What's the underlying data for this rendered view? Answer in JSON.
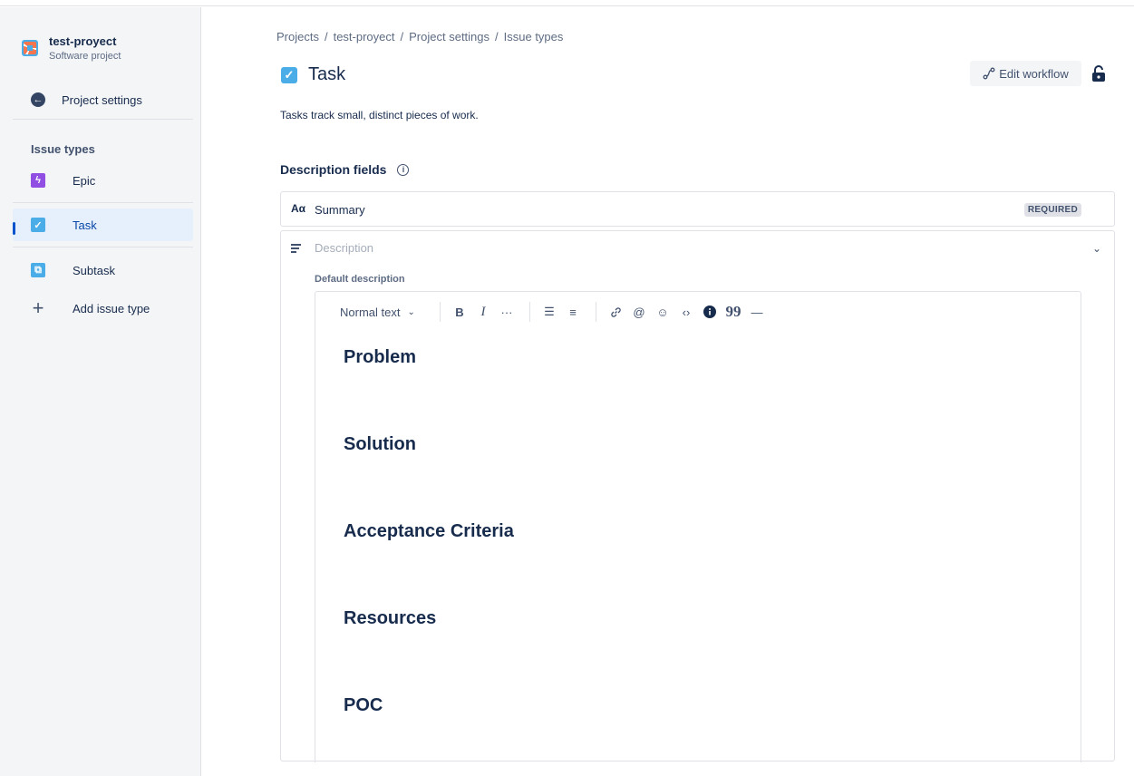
{
  "project": {
    "name": "test-proyect",
    "type": "Software project"
  },
  "sidebar": {
    "back_label": "Project settings",
    "section_title": "Issue types",
    "items": [
      {
        "label": "Epic",
        "icon": "epic-icon",
        "color": "#904EE2",
        "glyph": "ϟ"
      },
      {
        "label": "Task",
        "icon": "task-icon",
        "color": "#4BADE8",
        "glyph": "✓",
        "active": true
      },
      {
        "label": "Subtask",
        "icon": "subtask-icon",
        "color": "#4BADE8",
        "glyph": "⧉"
      }
    ],
    "add_label": "Add issue type"
  },
  "breadcrumb": [
    "Projects",
    "test-proyect",
    "Project settings",
    "Issue types"
  ],
  "page": {
    "title": "Task",
    "description": "Tasks track small, distinct pieces of work.",
    "edit_workflow": "Edit workflow"
  },
  "fields": {
    "heading": "Description fields",
    "summary": {
      "icon_text": "Aα",
      "label": "Summary",
      "badge": "REQUIRED"
    },
    "description": {
      "placeholder": "Description",
      "default_label": "Default description",
      "toolbar": {
        "text_style": "Normal text",
        "buttons": [
          "B",
          "I",
          "···",
          "☰",
          "≡",
          "🔗",
          "@",
          "☺",
          "‹›",
          "●",
          "99",
          "—"
        ]
      },
      "headings": [
        "Problem",
        "Solution",
        "Acceptance Criteria",
        "Resources",
        "POC"
      ]
    }
  }
}
